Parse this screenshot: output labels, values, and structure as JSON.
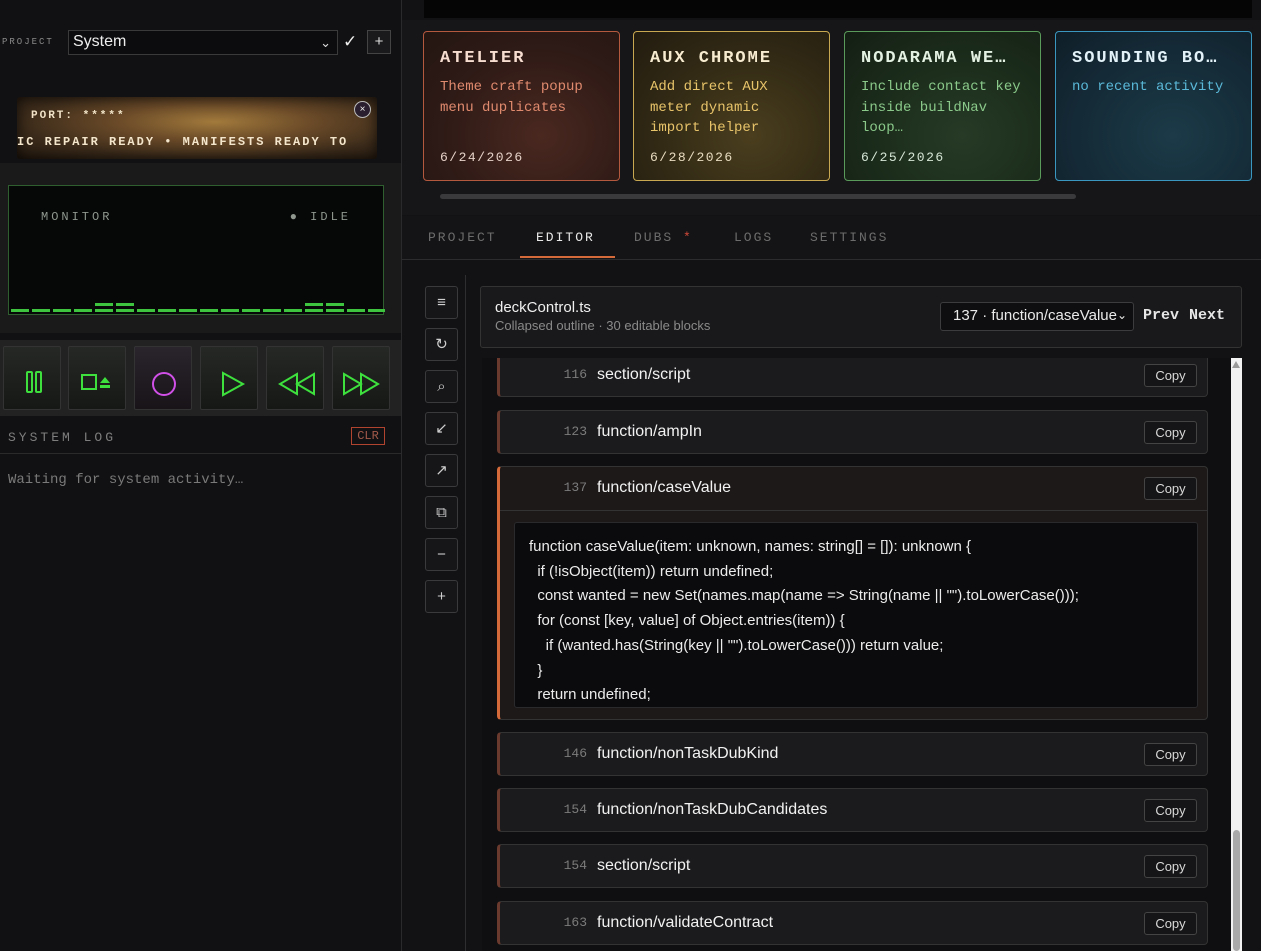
{
  "project": {
    "label": "PROJECT",
    "selected": "System",
    "confirm_icon": "✓",
    "add_icon": "+"
  },
  "marquee": {
    "port": "PORT: *****",
    "ticker": "IC REPAIR READY • MANIFESTS READY TO",
    "close_icon": "×"
  },
  "monitor": {
    "label": "MONITOR",
    "status": "● IDLE",
    "meter_levels": [
      1,
      1,
      1,
      1,
      2,
      2,
      1,
      1,
      1,
      1,
      1,
      1,
      1,
      1,
      2,
      2,
      1,
      1
    ]
  },
  "transport": {
    "buttons": [
      "pause",
      "stop-eject",
      "record",
      "play",
      "rewind",
      "fast-forward"
    ]
  },
  "system_log": {
    "title": "SYSTEM LOG",
    "clear_label": "CLR",
    "message": "Waiting for system activity…"
  },
  "cards": [
    {
      "title": "ATELIER",
      "desc": "Theme craft popup menu duplicates",
      "date": "6/24/2026",
      "color": "#e0876a"
    },
    {
      "title": "AUX CHROME",
      "desc": "Add direct AUX meter dynamic import helper",
      "date": "6/28/2026",
      "color": "#e8c46a"
    },
    {
      "title": "NODARAMA WE…",
      "desc": "Include contact key inside buildNav loop…",
      "date": "6/25/2026",
      "color": "#8ac98a"
    },
    {
      "title": "SOUNDING BO…",
      "desc": "no recent activity",
      "date": "",
      "color": "#5ab8d8"
    }
  ],
  "tabs": [
    {
      "label": "PROJECT",
      "active": false
    },
    {
      "label": "EDITOR",
      "active": true
    },
    {
      "label": "DUBS",
      "active": false,
      "flag": "*"
    },
    {
      "label": "LOGS",
      "active": false
    },
    {
      "label": "SETTINGS",
      "active": false
    }
  ],
  "toolbar": {
    "icons": [
      "≡",
      "↻",
      "⌕",
      "↙",
      "↗",
      "⧉",
      "−",
      "+"
    ]
  },
  "editor": {
    "file_name": "deckControl.ts",
    "file_sub": "Collapsed outline · 30 editable blocks",
    "block_select": "137 · function/caseValue",
    "prev_label": "Prev",
    "next_label": "Next",
    "copy_label": "Copy",
    "blocks": [
      {
        "line": "116",
        "name": "section/script"
      },
      {
        "line": "123",
        "name": "function/ampIn"
      },
      {
        "line": "137",
        "name": "function/caseValue",
        "open": true
      },
      {
        "line": "146",
        "name": "function/nonTaskDubKind"
      },
      {
        "line": "154",
        "name": "function/nonTaskDubCandidates"
      },
      {
        "line": "154",
        "name": "section/script"
      },
      {
        "line": "163",
        "name": "function/validateContract"
      }
    ],
    "code_lines": [
      "function caseValue(item: unknown, names: string[] = []): unknown {",
      "  if (!isObject(item)) return undefined;",
      "  const wanted = new Set(names.map(name => String(name || \"\").toLowerCase()));",
      "  for (const [key, value] of Object.entries(item)) {",
      "    if (wanted.has(String(key || \"\").toLowerCase())) return value;",
      "  }",
      "  return undefined;"
    ]
  }
}
